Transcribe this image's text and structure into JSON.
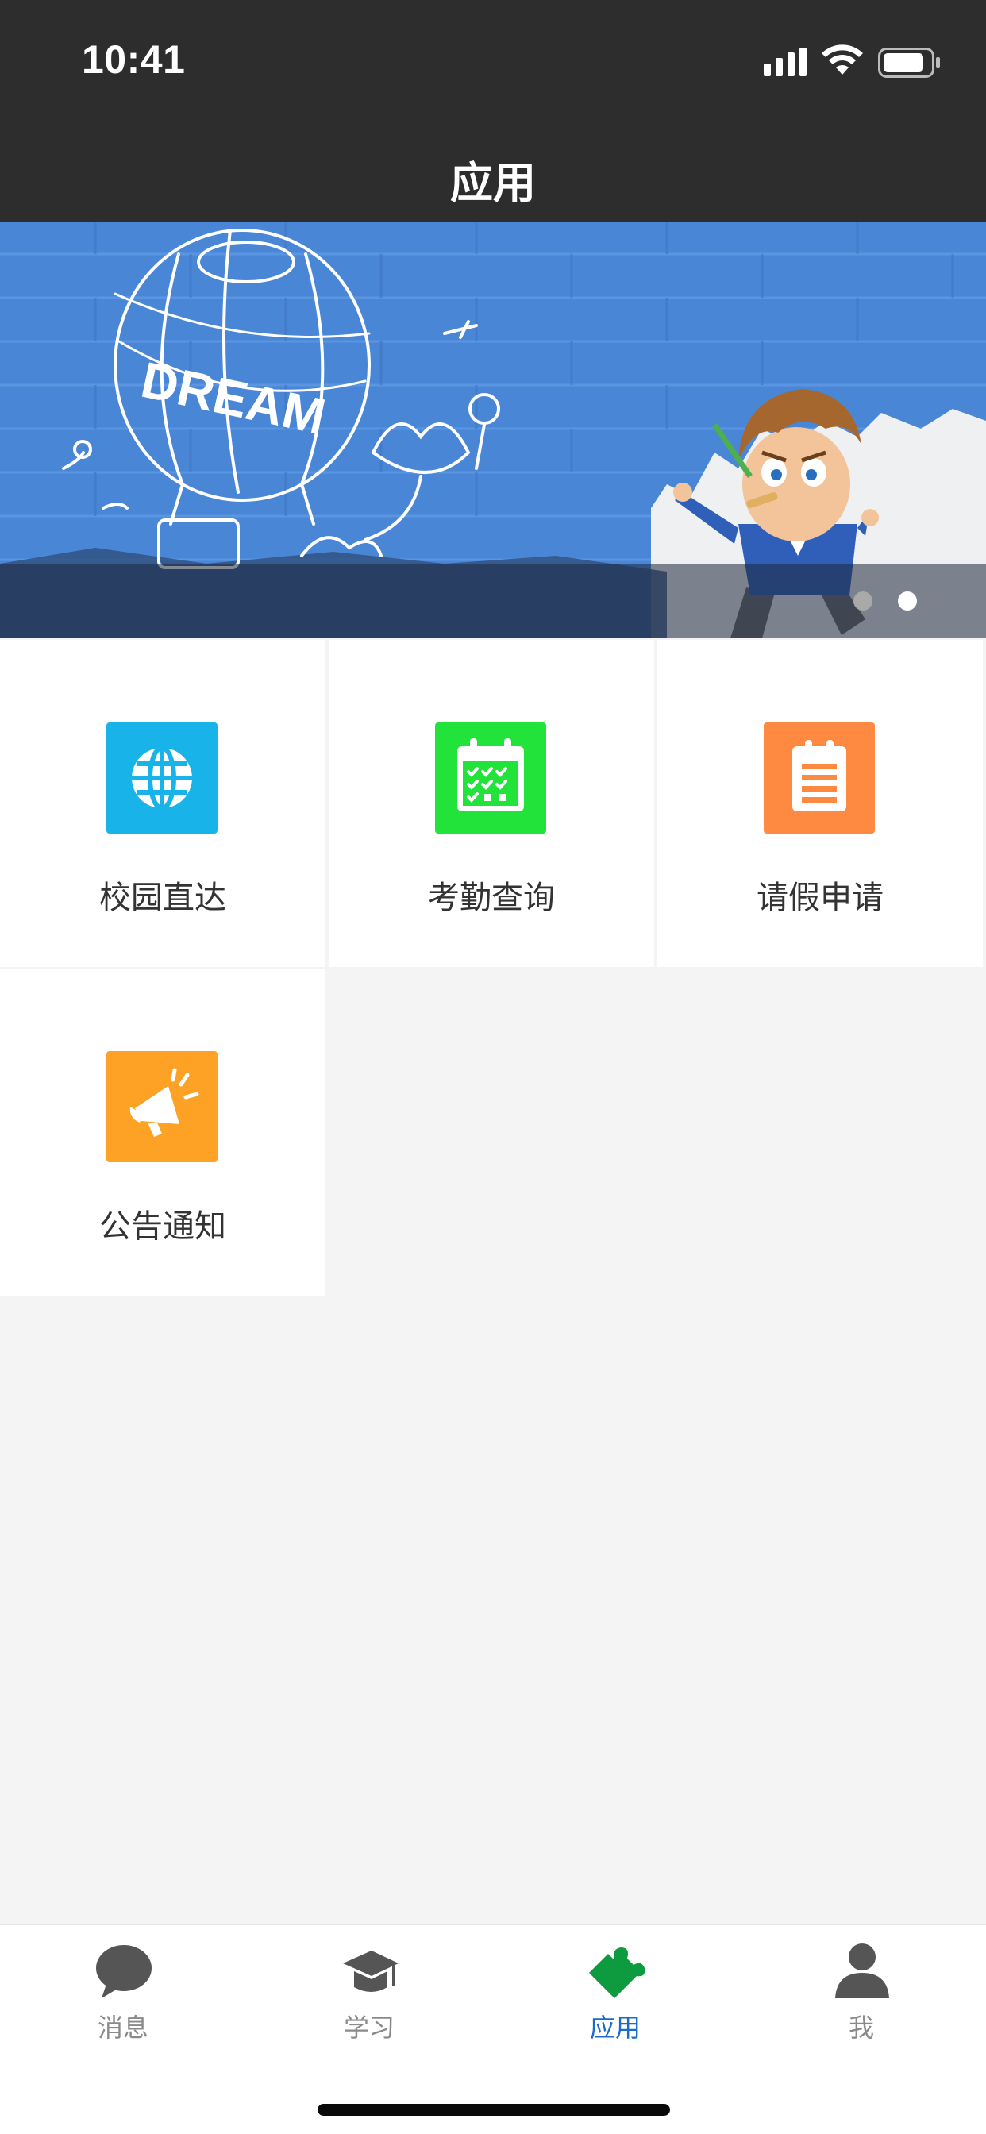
{
  "status_bar": {
    "time": "10:41"
  },
  "header": {
    "title": "应用"
  },
  "banner": {
    "text": "DREAM",
    "active_slide": 2,
    "slide_count": 2
  },
  "apps": [
    {
      "label": "校园直达",
      "icon": "globe-icon",
      "color": "#18b4e9"
    },
    {
      "label": "考勤查询",
      "icon": "calendar-icon",
      "color": "#22e33a"
    },
    {
      "label": "请假申请",
      "icon": "clipboard-icon",
      "color": "#fe8a41"
    },
    {
      "label": "公告通知",
      "icon": "megaphone-icon",
      "color": "#fda224"
    }
  ],
  "tabbar": {
    "items": [
      {
        "label": "消息",
        "icon": "chat-bubble-icon"
      },
      {
        "label": "学习",
        "icon": "graduation-cap-icon"
      },
      {
        "label": "应用",
        "icon": "puzzle-piece-icon",
        "active": true
      },
      {
        "label": "我",
        "icon": "person-icon"
      }
    ],
    "active_color": "#1a6cc8",
    "inactive_color": "#8a8a8a"
  }
}
